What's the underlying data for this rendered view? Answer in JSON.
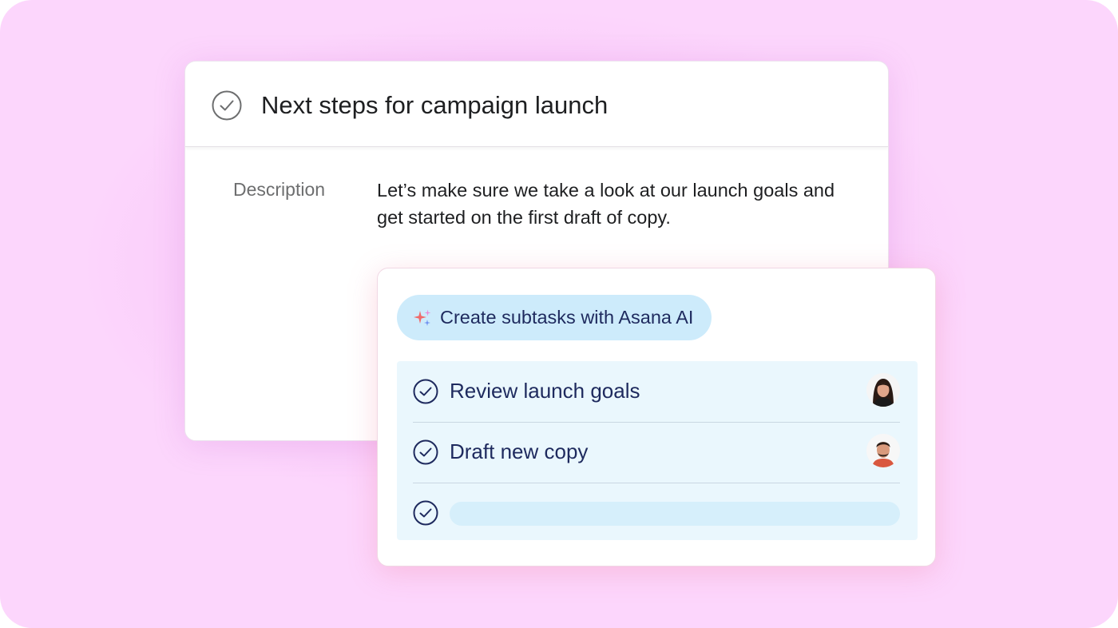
{
  "task": {
    "title": "Next steps for campaign launch",
    "check_icon": "check-circle-icon",
    "description_label": "Description",
    "description_text": "Let’s make sure we take a look at our launch goals and get started on the first draft of copy."
  },
  "ai": {
    "button_label": "Create subtasks with Asana AI",
    "button_icon": "sparkle-icon",
    "subtasks": [
      {
        "label": "Review launch goals",
        "assignee_avatar": "avatar-woman"
      },
      {
        "label": "Draft new copy",
        "assignee_avatar": "avatar-man"
      },
      {
        "label": "",
        "placeholder": true
      }
    ]
  },
  "colors": {
    "background": "#fcd6fc",
    "ai_pill": "#cdebfb",
    "subtask_bg": "#eaf7fd",
    "subtask_text": "#1e2a5e"
  }
}
